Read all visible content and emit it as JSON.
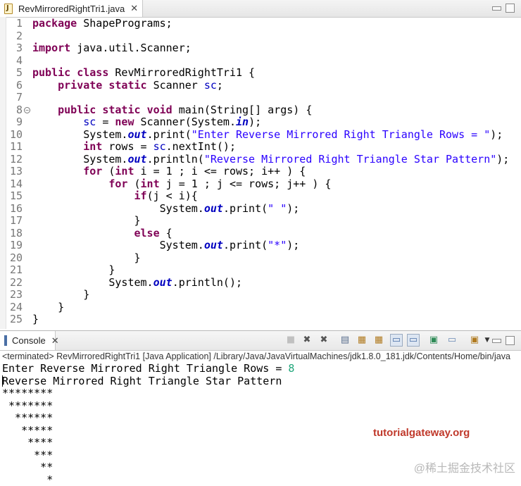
{
  "editor": {
    "tab_title": "RevMirroredRightTri1.java",
    "tab_close": "✕",
    "lines": [
      {
        "n": "1",
        "segs": [
          [
            "kw",
            "package"
          ],
          [
            "t",
            " ShapePrograms;"
          ]
        ]
      },
      {
        "n": "2",
        "segs": []
      },
      {
        "n": "3",
        "segs": [
          [
            "kw",
            "import"
          ],
          [
            "t",
            " java.util.Scanner;"
          ]
        ]
      },
      {
        "n": "4",
        "segs": []
      },
      {
        "n": "5",
        "segs": [
          [
            "kw",
            "public"
          ],
          [
            "t",
            " "
          ],
          [
            "kw",
            "class"
          ],
          [
            "t",
            " RevMirroredRightTri1 {"
          ]
        ]
      },
      {
        "n": "6",
        "segs": [
          [
            "t",
            "    "
          ],
          [
            "kw",
            "private"
          ],
          [
            "t",
            " "
          ],
          [
            "kw",
            "static"
          ],
          [
            "t",
            " Scanner "
          ],
          [
            "fld",
            "sc"
          ],
          [
            "t",
            ";"
          ]
        ]
      },
      {
        "n": "7",
        "segs": []
      },
      {
        "n": "8",
        "fold": true,
        "segs": [
          [
            "t",
            "    "
          ],
          [
            "kw",
            "public"
          ],
          [
            "t",
            " "
          ],
          [
            "kw",
            "static"
          ],
          [
            "t",
            " "
          ],
          [
            "kw",
            "void"
          ],
          [
            "t",
            " main(String[] args) {"
          ]
        ]
      },
      {
        "n": "9",
        "segs": [
          [
            "t",
            "        "
          ],
          [
            "fld",
            "sc"
          ],
          [
            "t",
            " = "
          ],
          [
            "kw",
            "new"
          ],
          [
            "t",
            " Scanner(System."
          ],
          [
            "sfi",
            "in"
          ],
          [
            "t",
            ");"
          ]
        ]
      },
      {
        "n": "10",
        "segs": [
          [
            "t",
            "        System."
          ],
          [
            "sfi",
            "out"
          ],
          [
            "t",
            ".print("
          ],
          [
            "str",
            "\"Enter Reverse Mirrored Right Triangle Rows = \""
          ],
          [
            "t",
            ");"
          ]
        ]
      },
      {
        "n": "11",
        "segs": [
          [
            "t",
            "        "
          ],
          [
            "kw",
            "int"
          ],
          [
            "t",
            " rows = "
          ],
          [
            "fld",
            "sc"
          ],
          [
            "t",
            ".nextInt();"
          ]
        ]
      },
      {
        "n": "12",
        "segs": [
          [
            "t",
            "        System."
          ],
          [
            "sfi",
            "out"
          ],
          [
            "t",
            ".println("
          ],
          [
            "str",
            "\"Reverse Mirrored Right Triangle Star Pattern\""
          ],
          [
            "t",
            ");"
          ]
        ]
      },
      {
        "n": "13",
        "segs": [
          [
            "t",
            "        "
          ],
          [
            "kw",
            "for"
          ],
          [
            "t",
            " ("
          ],
          [
            "kw",
            "int"
          ],
          [
            "t",
            " i = 1 ; i <= rows; i++ ) {"
          ]
        ]
      },
      {
        "n": "14",
        "segs": [
          [
            "t",
            "            "
          ],
          [
            "kw",
            "for"
          ],
          [
            "t",
            " ("
          ],
          [
            "kw",
            "int"
          ],
          [
            "t",
            " j = 1 ; j <= rows; j++ ) {"
          ]
        ]
      },
      {
        "n": "15",
        "segs": [
          [
            "t",
            "                "
          ],
          [
            "kw",
            "if"
          ],
          [
            "t",
            "(j < i){"
          ]
        ]
      },
      {
        "n": "16",
        "segs": [
          [
            "t",
            "                    System."
          ],
          [
            "sfi",
            "out"
          ],
          [
            "t",
            ".print("
          ],
          [
            "str",
            "\" \""
          ],
          [
            "t",
            ");"
          ]
        ]
      },
      {
        "n": "17",
        "segs": [
          [
            "t",
            "                }"
          ]
        ]
      },
      {
        "n": "18",
        "segs": [
          [
            "t",
            "                "
          ],
          [
            "kw",
            "else"
          ],
          [
            "t",
            " {"
          ]
        ]
      },
      {
        "n": "19",
        "segs": [
          [
            "t",
            "                    System."
          ],
          [
            "sfi",
            "out"
          ],
          [
            "t",
            ".print("
          ],
          [
            "str",
            "\"*\""
          ],
          [
            "t",
            ");"
          ]
        ]
      },
      {
        "n": "20",
        "segs": [
          [
            "t",
            "                }"
          ]
        ]
      },
      {
        "n": "21",
        "segs": [
          [
            "t",
            "            }"
          ]
        ]
      },
      {
        "n": "22",
        "segs": [
          [
            "t",
            "            System."
          ],
          [
            "sfi",
            "out"
          ],
          [
            "t",
            ".println();"
          ]
        ]
      },
      {
        "n": "23",
        "segs": [
          [
            "t",
            "        }"
          ]
        ]
      },
      {
        "n": "24",
        "segs": [
          [
            "t",
            "    }"
          ]
        ]
      },
      {
        "n": "25",
        "segs": [
          [
            "t",
            "}"
          ]
        ]
      }
    ]
  },
  "console": {
    "tab_title": "Console",
    "tab_close": "✕",
    "status": "<terminated> RevMirroredRightTri1 [Java Application] /Library/Java/JavaVirtualMachines/jdk1.8.0_181.jdk/Contents/Home/bin/java",
    "prompt": "Enter Reverse Mirrored Right Triangle Rows = ",
    "user_input": "8",
    "output_lines": [
      "Reverse Mirrored Right Triangle Star Pattern",
      "********",
      " *******",
      "  ******",
      "   *****",
      "    ****",
      "     ***",
      "      **",
      "       *"
    ],
    "toolbar_icons": [
      "terminate-icon",
      "remove-launch-icon",
      "remove-all-icon",
      "clear-console-icon",
      "scroll-lock-icon",
      "word-wrap-icon",
      "show-stdout-icon",
      "show-stderr-icon",
      "pin-console-icon",
      "display-console-icon",
      "open-console-icon",
      "view-menu-icon"
    ]
  },
  "branding": {
    "logo_text": "tutorialgateway.org",
    "watermark": "@稀土掘金技术社区"
  }
}
